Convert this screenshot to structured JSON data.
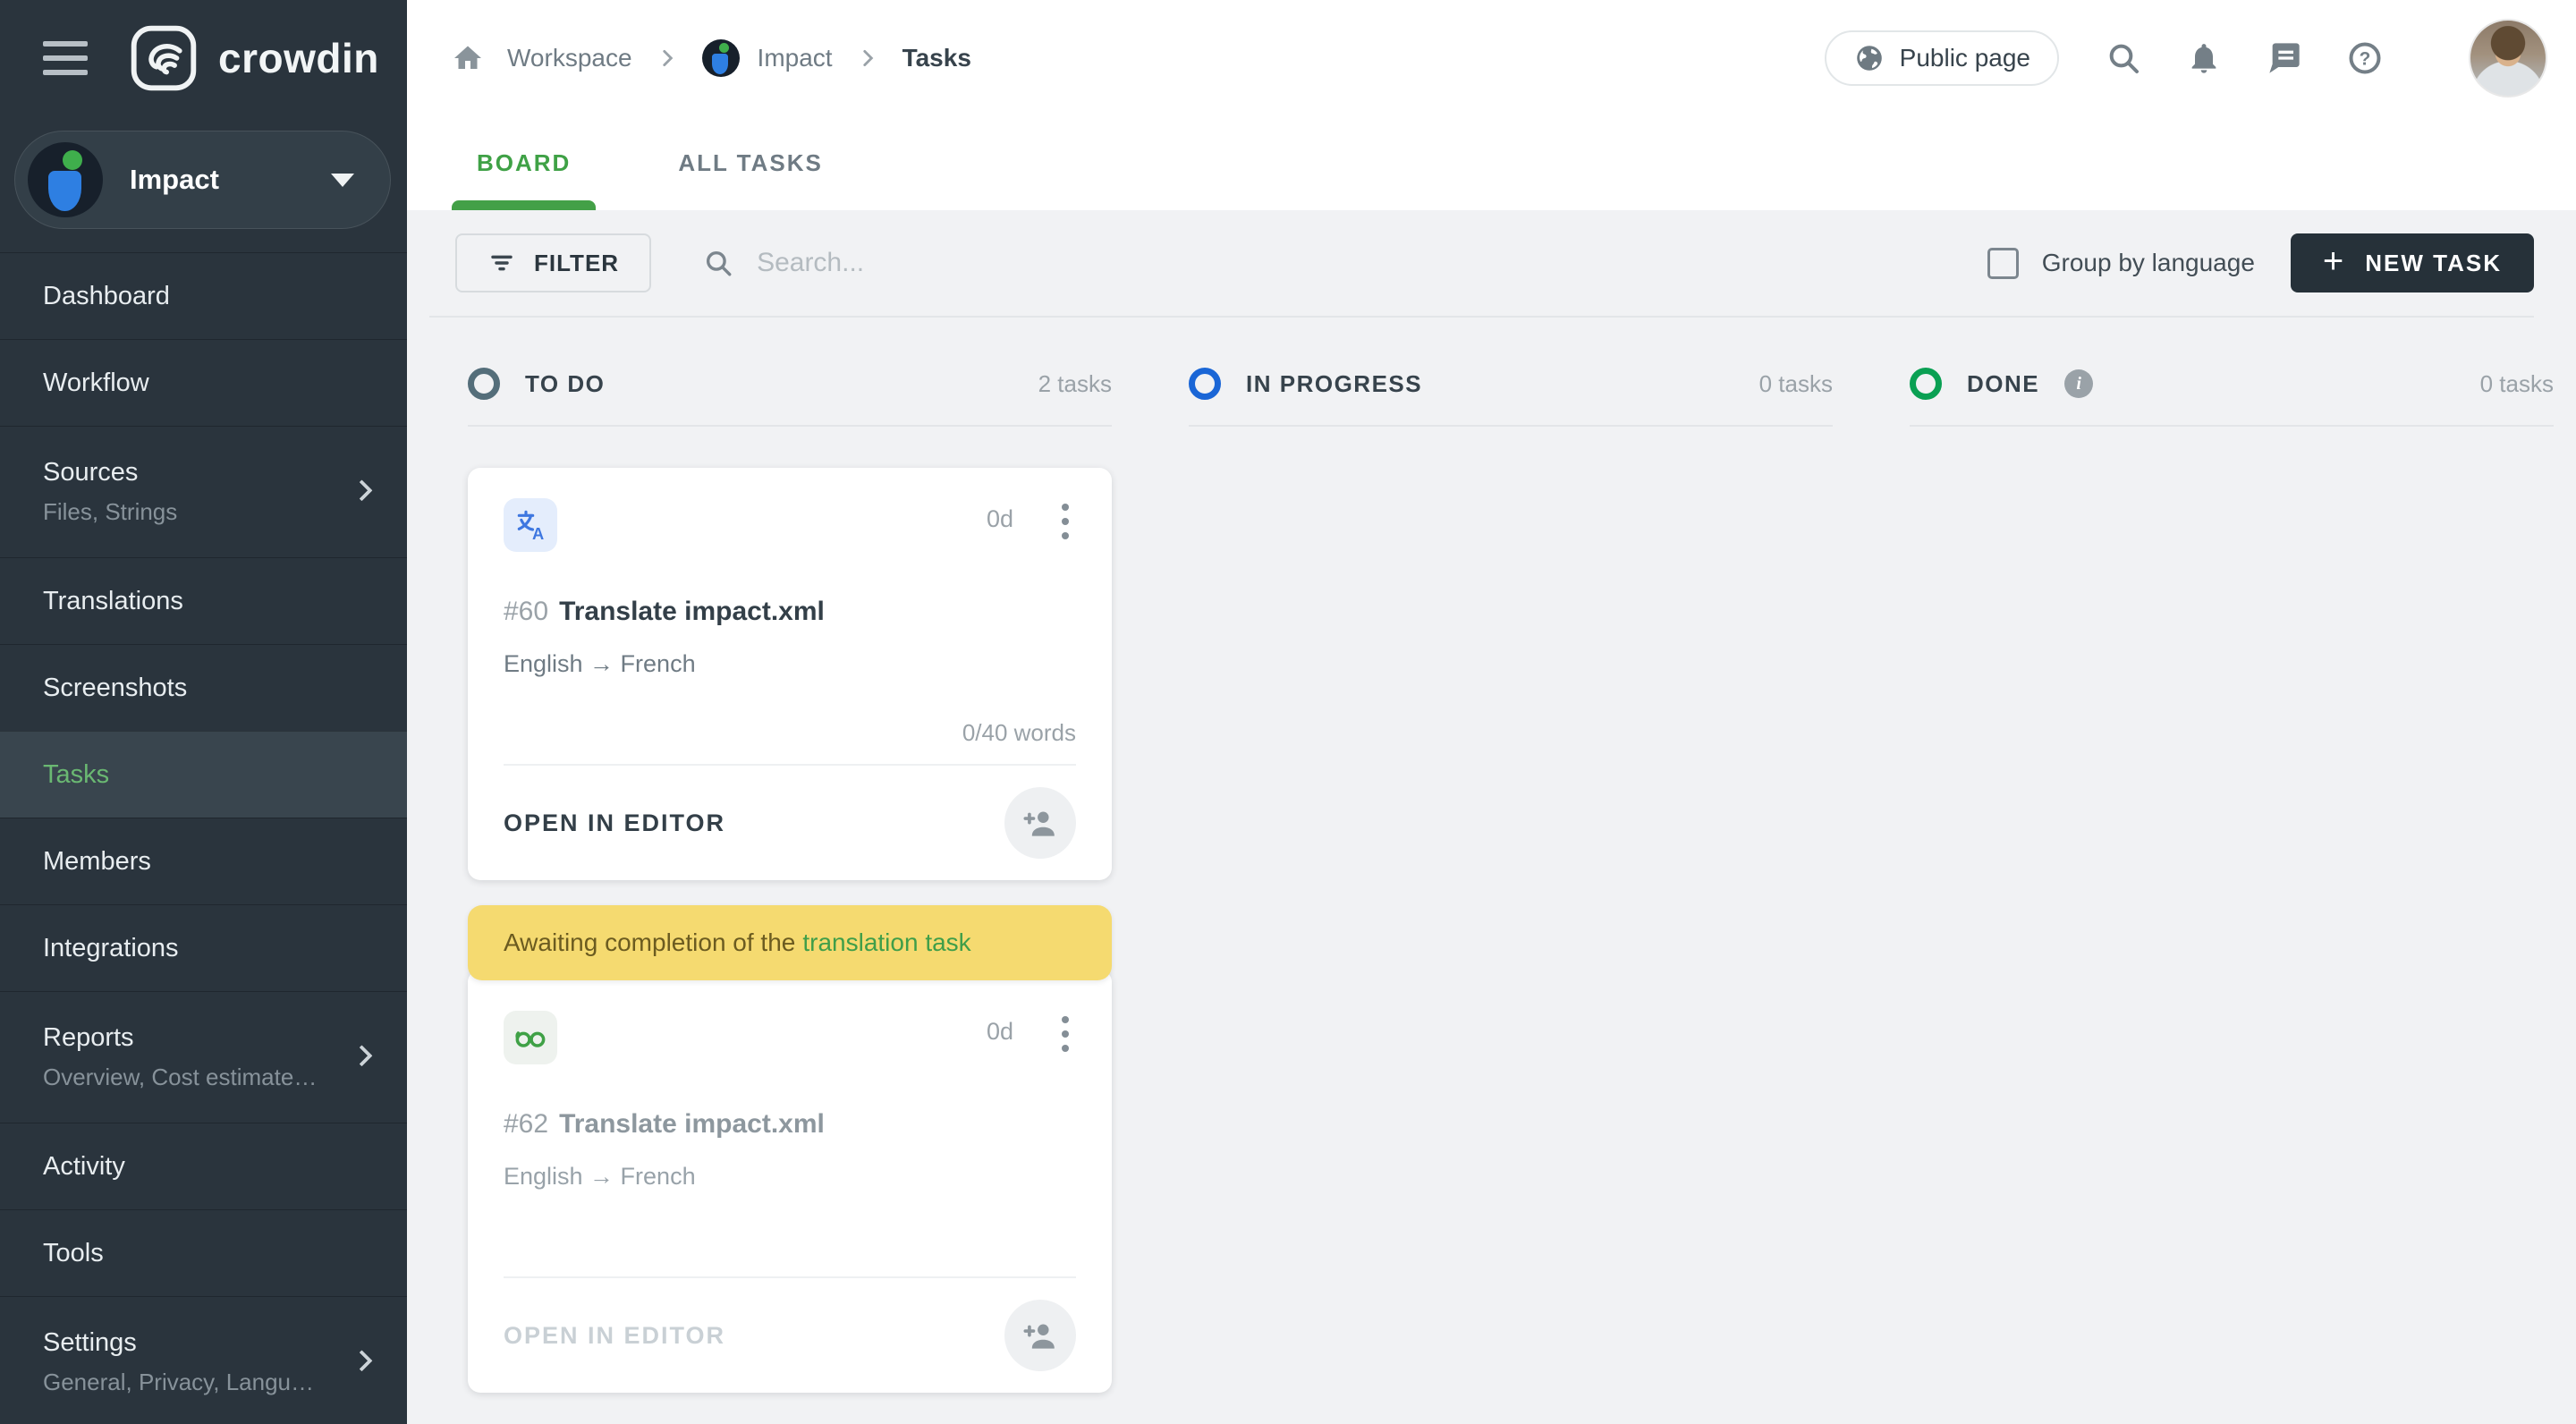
{
  "brand": {
    "name": "crowdin"
  },
  "sidebar": {
    "project": {
      "name": "Impact"
    },
    "items": [
      {
        "label": "Dashboard"
      },
      {
        "label": "Workflow"
      },
      {
        "label": "Sources",
        "subtitle": "Files, Strings"
      },
      {
        "label": "Translations"
      },
      {
        "label": "Screenshots"
      },
      {
        "label": "Tasks"
      },
      {
        "label": "Members"
      },
      {
        "label": "Integrations"
      },
      {
        "label": "Reports",
        "subtitle": "Overview, Cost estimate, Transl…"
      },
      {
        "label": "Activity"
      },
      {
        "label": "Tools"
      },
      {
        "label": "Settings",
        "subtitle": "General, Privacy, Languages, Q…"
      }
    ]
  },
  "topbar": {
    "breadcrumb": {
      "workspace": "Workspace",
      "project": "Impact",
      "current": "Tasks"
    },
    "public_page": "Public page"
  },
  "tabs": {
    "board": "BOARD",
    "all_tasks": "ALL TASKS"
  },
  "toolbar": {
    "filter": "FILTER",
    "search_placeholder": "Search...",
    "group_by_language": "Group by language",
    "new_task": "NEW TASK"
  },
  "board": {
    "columns": [
      {
        "title": "TO DO",
        "count": "2 tasks",
        "ring_color": "#546e7a"
      },
      {
        "title": "IN PROGRESS",
        "count": "0 tasks",
        "ring_color": "#1a66d6"
      },
      {
        "title": "DONE",
        "count": "0 tasks",
        "ring_color": "#0aa053"
      }
    ],
    "cards": [
      {
        "id": "#60",
        "title": "Translate impact.xml",
        "languages": "English → French",
        "duration": "0d",
        "words": "0/40 words",
        "action": "OPEN IN EDITOR",
        "type": "translate"
      },
      {
        "id": "#62",
        "title": "Translate impact.xml",
        "languages": "English → French",
        "duration": "0d",
        "action": "OPEN IN EDITOR",
        "type": "proofread",
        "banner_text": "Awaiting completion of the",
        "banner_link": "translation task"
      }
    ]
  },
  "colors": {
    "accent_green": "#43a047",
    "banner_bg": "#f5da70",
    "new_task_bg": "#263139"
  }
}
